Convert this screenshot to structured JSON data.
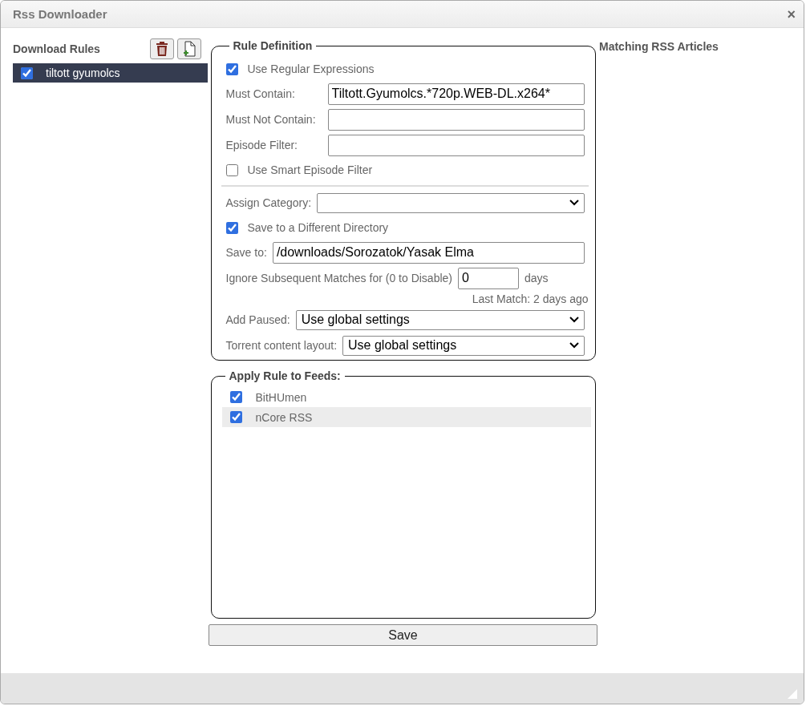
{
  "window": {
    "title": "Rss Downloader",
    "close": "×"
  },
  "download_rules": {
    "title": "Download Rules",
    "items": [
      {
        "label": "tiltott gyumolcs",
        "checked": true,
        "selected": true
      }
    ]
  },
  "rule_definition": {
    "title": "Rule Definition",
    "use_regex": {
      "label": "Use Regular Expressions",
      "checked": true
    },
    "must_contain": {
      "label": "Must Contain:",
      "value": "Tiltott.Gyumolcs.*720p.WEB-DL.x264*"
    },
    "must_not_contain": {
      "label": "Must Not Contain:"
    },
    "episode_filter": {
      "label": "Episode Filter:"
    },
    "smart_filter": {
      "label": "Use Smart Episode Filter",
      "checked": false
    },
    "assign_category": {
      "label": "Assign Category:"
    },
    "save_different": {
      "label": "Save to a Different Directory",
      "checked": true
    },
    "save_to": {
      "label": "Save to:",
      "value": "/downloads/Sorozatok/Yasak Elma"
    },
    "ignore": {
      "label": "Ignore Subsequent Matches for (0 to Disable)",
      "value": "0",
      "unit": "days"
    },
    "last_match": "Last Match: 2 days ago",
    "add_paused": {
      "label": "Add Paused:",
      "value": "Use global settings"
    },
    "content_layout": {
      "label": "Torrent content layout:",
      "value": "Use global settings"
    }
  },
  "feeds": {
    "title": "Apply Rule to Feeds:",
    "items": [
      {
        "label": "BitHUmen",
        "checked": true,
        "highlighted": false
      },
      {
        "label": "nCore RSS",
        "checked": true,
        "highlighted": true
      }
    ]
  },
  "save_button": "Save",
  "matching": {
    "title": "Matching RSS Articles"
  }
}
